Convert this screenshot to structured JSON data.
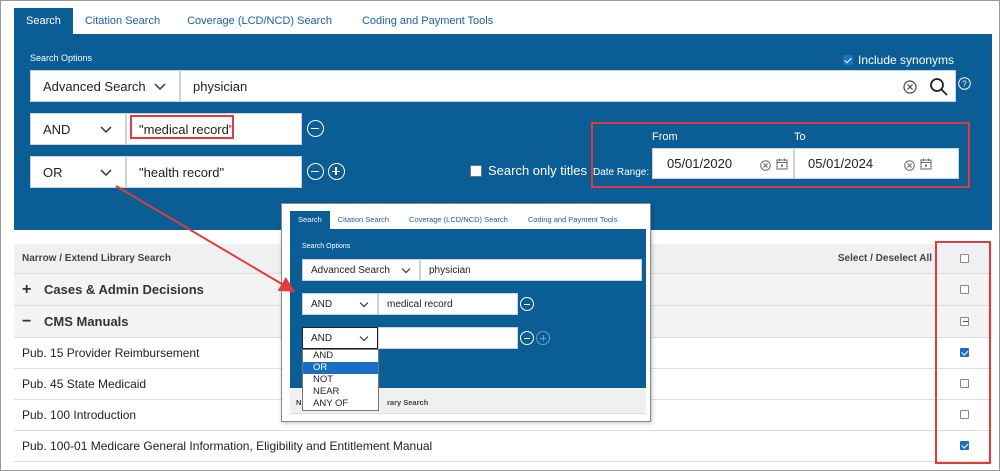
{
  "tabs": [
    "Search",
    "Citation Search",
    "Coverage (LCD/NCD) Search",
    "Coding and Payment Tools"
  ],
  "search": {
    "options_label": "Search Options",
    "include_synonyms_label": "Include synonyms",
    "include_synonyms_checked": true,
    "mode": "Advanced Search",
    "query": "physician",
    "rows": [
      {
        "operator": "AND",
        "value": "\"medical record\""
      },
      {
        "operator": "OR",
        "value": "\"health record\""
      }
    ],
    "only_titles_label": "Search only titles",
    "date_range_label": "Date Range:",
    "from_label": "From",
    "to_label": "To",
    "from_date": "05/01/2020",
    "to_date": "05/01/2024"
  },
  "library": {
    "header": "Narrow / Extend Library Search",
    "select_all": "Select / Deselect All",
    "groups": [
      {
        "toggle": "+",
        "label": "Cases & Admin Decisions"
      },
      {
        "toggle": "−",
        "label": "CMS Manuals"
      }
    ],
    "items": [
      {
        "label": "Pub. 15 Provider Reimbursement",
        "checked": true
      },
      {
        "label": "Pub. 45 State Medicaid",
        "checked": false
      },
      {
        "label": "Pub. 100 Introduction",
        "checked": false
      },
      {
        "label": "Pub. 100-01 Medicare General Information, Eligibility and Entitlement Manual",
        "checked": true
      }
    ]
  },
  "inset": {
    "tabs": [
      "Search",
      "Citation Search",
      "Coverage (LCD/NCD) Search",
      "Coding and Payment Tools"
    ],
    "options_label": "Search Options",
    "mode": "Advanced Search",
    "query": "physician",
    "row1_operator": "AND",
    "row1_value": "medical record",
    "row2_operator": "AND",
    "dropdown_options": [
      "AND",
      "OR",
      "NOT",
      "NEAR",
      "ANY OF"
    ],
    "dropdown_highlight": "OR",
    "footer_start": "N",
    "footer_end": "rary Search"
  },
  "colors": {
    "panel": "#0b5d96",
    "highlight": "#e03c3c",
    "accent": "#1a6fc2"
  }
}
